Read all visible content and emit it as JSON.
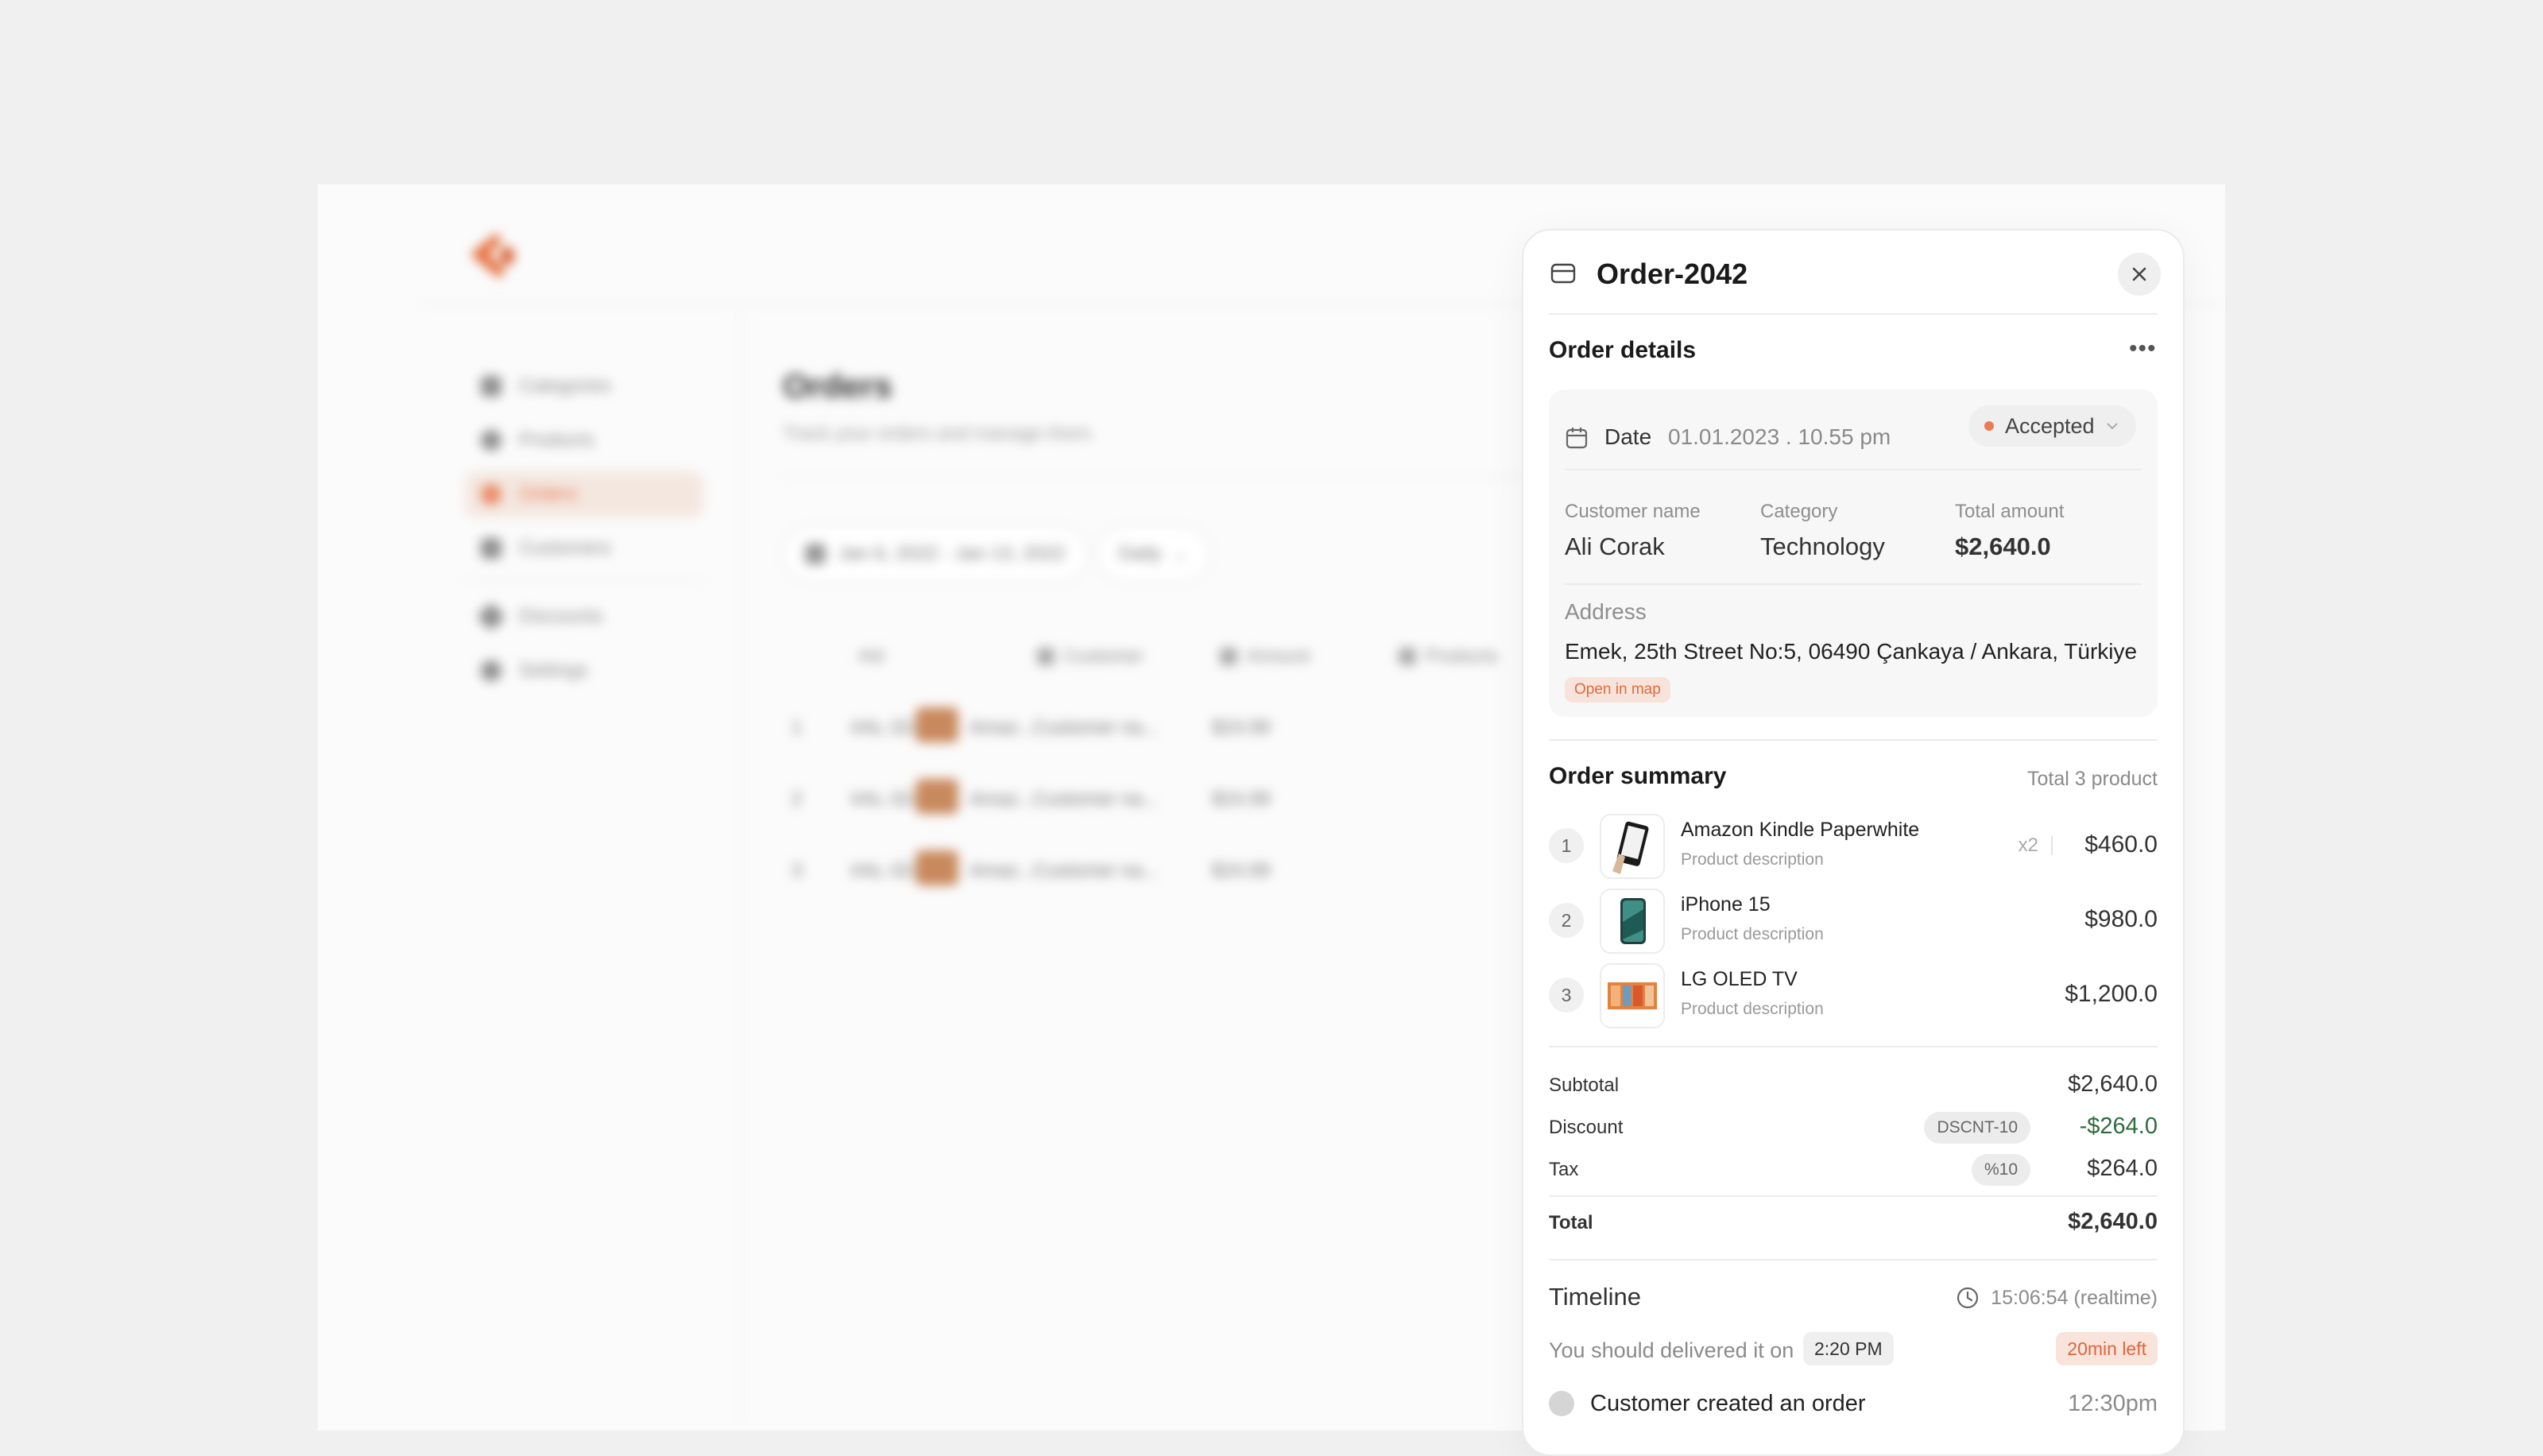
{
  "background_app": {
    "nav_items": [
      {
        "label": "Categories"
      },
      {
        "label": "Products"
      },
      {
        "label": "Orders"
      },
      {
        "label": "Customers"
      },
      {
        "label": "Discounts"
      },
      {
        "label": "Settings"
      }
    ],
    "page_title": "Orders",
    "page_subtitle": "Track your orders and manage them.",
    "date_range": "Jan 6, 2022 - Jan 13, 2022",
    "period": "Daily",
    "table_headers": [
      "#Id",
      "Customer",
      "Amount",
      "Products"
    ],
    "rows": [
      {
        "num": "1",
        "id": "#AL-3245",
        "customer": "Customer na...",
        "amount": "$24.99",
        "product": "Amaz..."
      },
      {
        "num": "2",
        "id": "#AL-3245",
        "customer": "Customer na...",
        "amount": "$24.99",
        "product": "Amaz..."
      },
      {
        "num": "3",
        "id": "#AL-3245",
        "customer": "Customer na...",
        "amount": "$24.99",
        "product": "Amaz..."
      }
    ]
  },
  "panel": {
    "title": "Order-2042",
    "details_title": "Order details",
    "date_label": "Date",
    "date_value": "01.01.2023 . 10.55 pm",
    "status": "Accepted",
    "status_color": "#ea7b54",
    "customer_label": "Customer name",
    "customer_value": "Ali Corak",
    "category_label": "Category",
    "category_value": "Technology",
    "total_label": "Total amount",
    "total_value": "$2,640.0",
    "address_label": "Address",
    "address_value": "Emek, 25th Street No:5, 06490 Çankaya / Ankara, Türkiye",
    "open_map": "Open in map",
    "summary_title": "Order summary",
    "summary_count": "Total 3 product",
    "products": [
      {
        "index": "1",
        "name": "Amazon Kindle Paperwhite",
        "desc": "Product description",
        "qty": "x2",
        "price": "$460.0",
        "icon": "kindle-thumb"
      },
      {
        "index": "2",
        "name": "iPhone 15",
        "desc": "Product description",
        "qty": "",
        "price": "$980.0",
        "icon": "iphone-thumb"
      },
      {
        "index": "3",
        "name": "LG OLED TV",
        "desc": "Product description",
        "qty": "",
        "price": "$1,200.0",
        "icon": "tv-thumb"
      }
    ],
    "subtotal_label": "Subtotal",
    "subtotal_value": "$2,640.0",
    "discount_label": "Discount",
    "discount_code": "DSCNT-10",
    "discount_value": "-$264.0",
    "discount_color": "#2f6b3f",
    "tax_label": "Tax",
    "tax_rate": "%10",
    "tax_value": "$264.0",
    "grand_total_label": "Total",
    "grand_total_value": "$2,640.0",
    "timeline_title": "Timeline",
    "realtime": "15:06:54 (realtime)",
    "deliver_text": "You should delivered it on",
    "deliver_time": "2:20 PM",
    "time_left": "20min left",
    "events": [
      {
        "label": "Customer created an order",
        "time": "12:30pm"
      }
    ]
  }
}
